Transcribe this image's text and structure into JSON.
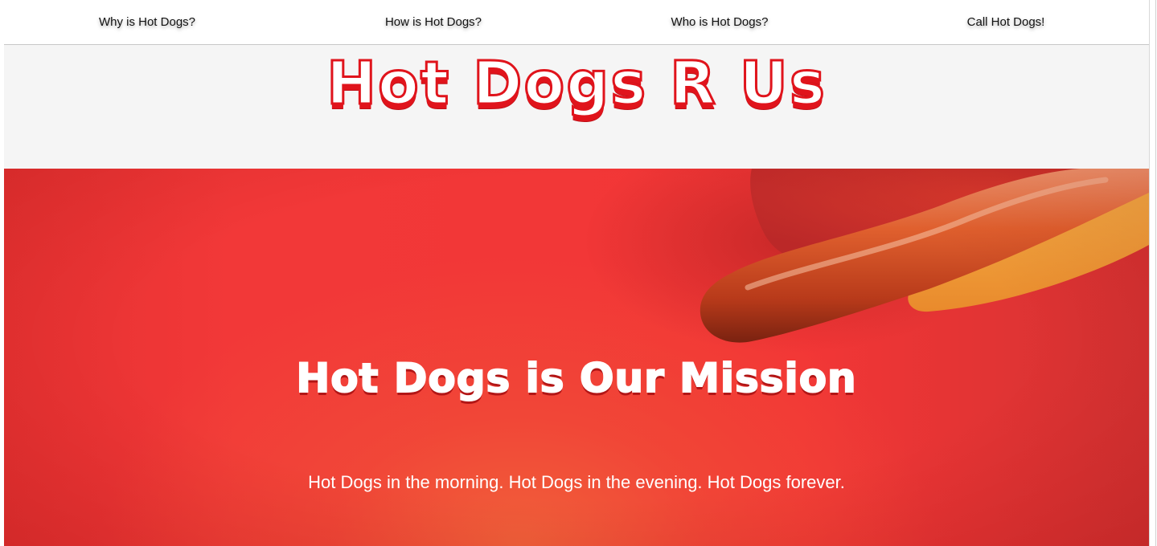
{
  "nav": {
    "items": [
      {
        "label": "Why is Hot Dogs?"
      },
      {
        "label": "How is Hot Dogs?"
      },
      {
        "label": "Who is Hot Dogs?"
      },
      {
        "label": "Call Hot Dogs!"
      }
    ]
  },
  "header": {
    "title": "Hot Dogs R Us"
  },
  "hero": {
    "heading": "Hot Dogs is Our Mission",
    "subtext": "Hot Dogs in the morning. Hot Dogs in the evening. Hot Dogs forever.",
    "image": "hot-dog-photo"
  },
  "colors": {
    "title_red": "#e0141c",
    "hero_red": "#f23838",
    "page_bg": "#f5f5f5",
    "nav_bg": "#ffffff"
  }
}
